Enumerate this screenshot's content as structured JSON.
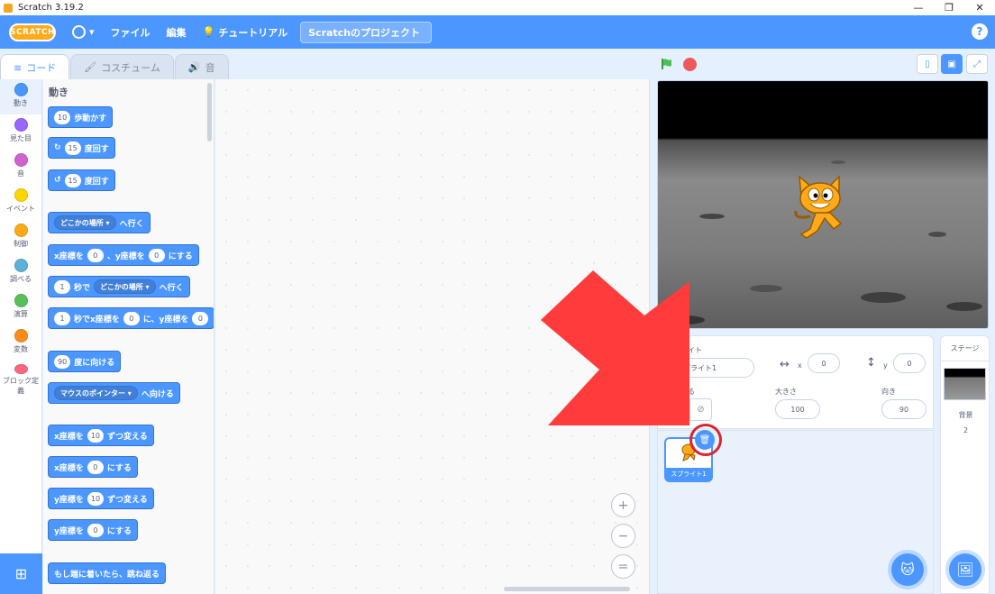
{
  "window": {
    "title": "Scratch 3.19.2",
    "min": "—",
    "max": "❐",
    "close": "✕"
  },
  "menu": {
    "logo": "SCRATCH",
    "file": "ファイル",
    "edit": "編集",
    "tutorials": "チュートリアル",
    "project_title": "Scratchのプロジェクト",
    "help": "?"
  },
  "tabs": [
    {
      "label": "コード",
      "icon": "code-icon"
    },
    {
      "label": "コスチューム",
      "icon": "brush-icon"
    },
    {
      "label": "音",
      "icon": "speaker-icon"
    }
  ],
  "categories": [
    {
      "label": "動き",
      "color": "#4c97ff"
    },
    {
      "label": "見た目",
      "color": "#9966ff"
    },
    {
      "label": "音",
      "color": "#cf63cf"
    },
    {
      "label": "イベント",
      "color": "#ffd500"
    },
    {
      "label": "制御",
      "color": "#ffab19"
    },
    {
      "label": "調べる",
      "color": "#5cb1d6"
    },
    {
      "label": "演算",
      "color": "#59c059"
    },
    {
      "label": "変数",
      "color": "#ff8c1a"
    },
    {
      "label": "ブロック定義",
      "color": "#ff6680"
    }
  ],
  "palette": {
    "heading": "動き",
    "b1": {
      "num": "10",
      "text": "歩動かす"
    },
    "b2": {
      "num": "15",
      "text": "度回す"
    },
    "b3": {
      "num": "15",
      "text": "度回す"
    },
    "b4": {
      "drop": "どこかの場所 ▾",
      "text": "へ行く"
    },
    "b5": {
      "t1": "x座標を",
      "n1": "0",
      "t2": "、y座標を",
      "n2": "0",
      "t3": "にする"
    },
    "b6": {
      "num": "1",
      "t1": "秒で",
      "drop": "どこかの場所 ▾",
      "t2": "へ行く"
    },
    "b7": {
      "num": "1",
      "t1": "秒でx座標を",
      "n2": "0",
      "t2": "に、y座標を",
      "n3": "0"
    },
    "b8": {
      "num": "90",
      "text": "度に向ける"
    },
    "b9": {
      "drop": "マウスのポインター ▾",
      "text": "へ向ける"
    },
    "b10": {
      "t1": "x座標を",
      "num": "10",
      "t2": "ずつ変える"
    },
    "b11": {
      "t1": "x座標を",
      "num": "0",
      "t2": "にする"
    },
    "b12": {
      "t1": "y座標を",
      "num": "10",
      "t2": "ずつ変える"
    },
    "b13": {
      "t1": "y座標を",
      "num": "0",
      "t2": "にする"
    },
    "b14": {
      "text": "もし端に着いたら、跳ね返る"
    }
  },
  "zoom": {
    "in": "+",
    "out": "−",
    "reset": "="
  },
  "sprite_info": {
    "sprite_label": "スプライト",
    "sprite_name": "スプライト1",
    "x_label": "x",
    "x_value": "0",
    "y_label": "y",
    "y_value": "0",
    "show_label": "表示する",
    "size_label": "大きさ",
    "size_value": "100",
    "direction_label": "向き",
    "direction_value": "90"
  },
  "sprite_tile": {
    "name": "スプライト1"
  },
  "stage_panel": {
    "header": "ステージ",
    "backdrop_label": "背景",
    "backdrop_count": "2"
  },
  "arrow_color": "#ff3b3b"
}
